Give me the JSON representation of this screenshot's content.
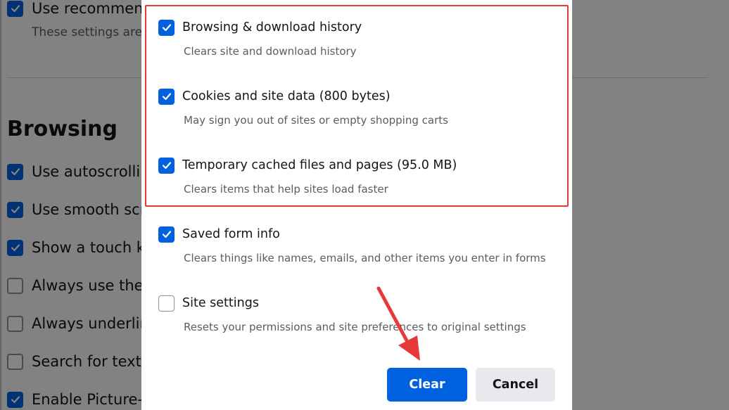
{
  "background": {
    "top_items": [
      {
        "label": "Use recommenc",
        "checked": true
      },
      {
        "sublabel": "These settings are"
      }
    ],
    "heading": "Browsing",
    "items": [
      {
        "label": "Use autoscrolling",
        "checked": true
      },
      {
        "label": "Use smooth scro",
        "checked": true
      },
      {
        "label": "Show a touch ke",
        "checked": true
      },
      {
        "label": "Always use the c",
        "checked": false
      },
      {
        "label": "Always underlin",
        "checked": false
      },
      {
        "label": "Search for text v",
        "checked": false
      },
      {
        "label": "Enable Picture-i",
        "checked": true
      }
    ]
  },
  "dialog": {
    "options": [
      {
        "label": "Browsing & download history",
        "description": "Clears site and download history",
        "checked": true
      },
      {
        "label": "Cookies and site data (800 bytes)",
        "description": "May sign you out of sites or empty shopping carts",
        "checked": true
      },
      {
        "label": "Temporary cached files and pages (95.0 MB)",
        "description": "Clears items that help sites load faster",
        "checked": true
      },
      {
        "label": "Saved form info",
        "description": "Clears things like names, emails, and other items you enter in forms",
        "checked": true
      },
      {
        "label": "Site settings",
        "description": "Resets your permissions and site preferences to original settings",
        "checked": false
      }
    ],
    "buttons": {
      "clear": "Clear",
      "cancel": "Cancel"
    }
  },
  "annotations": {
    "highlight_color": "#e5393a",
    "arrow_color": "#e5393a"
  },
  "colors": {
    "accent": "#0061e0",
    "overlay": "rgba(0,0,0,0.48)"
  }
}
